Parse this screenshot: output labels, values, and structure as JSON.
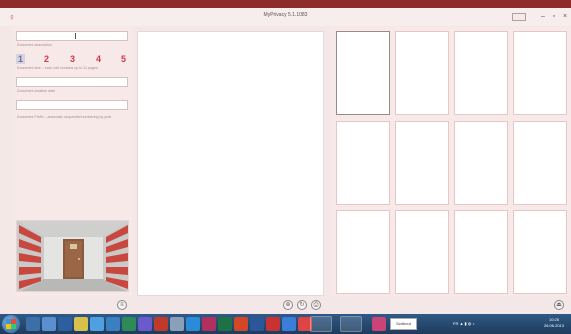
{
  "window": {
    "title": "MyPrivacy 5.1.1083",
    "help_label": "",
    "minimize": "–",
    "maximize": "▫",
    "close": "×"
  },
  "left": {
    "description_value": "",
    "description_label": "Document description",
    "pages": [
      "1",
      "2",
      "3",
      "4",
      "5"
    ],
    "pages_label": "Document size – each cell contains up to 11 pages",
    "creation_date_value": "",
    "creation_date_label": "Document creation date",
    "prefix_value": "",
    "prefix_label": "Document Prefix – automatic sequential numbering by year"
  },
  "taskbar": {
    "running_label": "Scribout",
    "tray_text": "FR",
    "clock_time": "10:25",
    "clock_date": "26.06.2013"
  }
}
